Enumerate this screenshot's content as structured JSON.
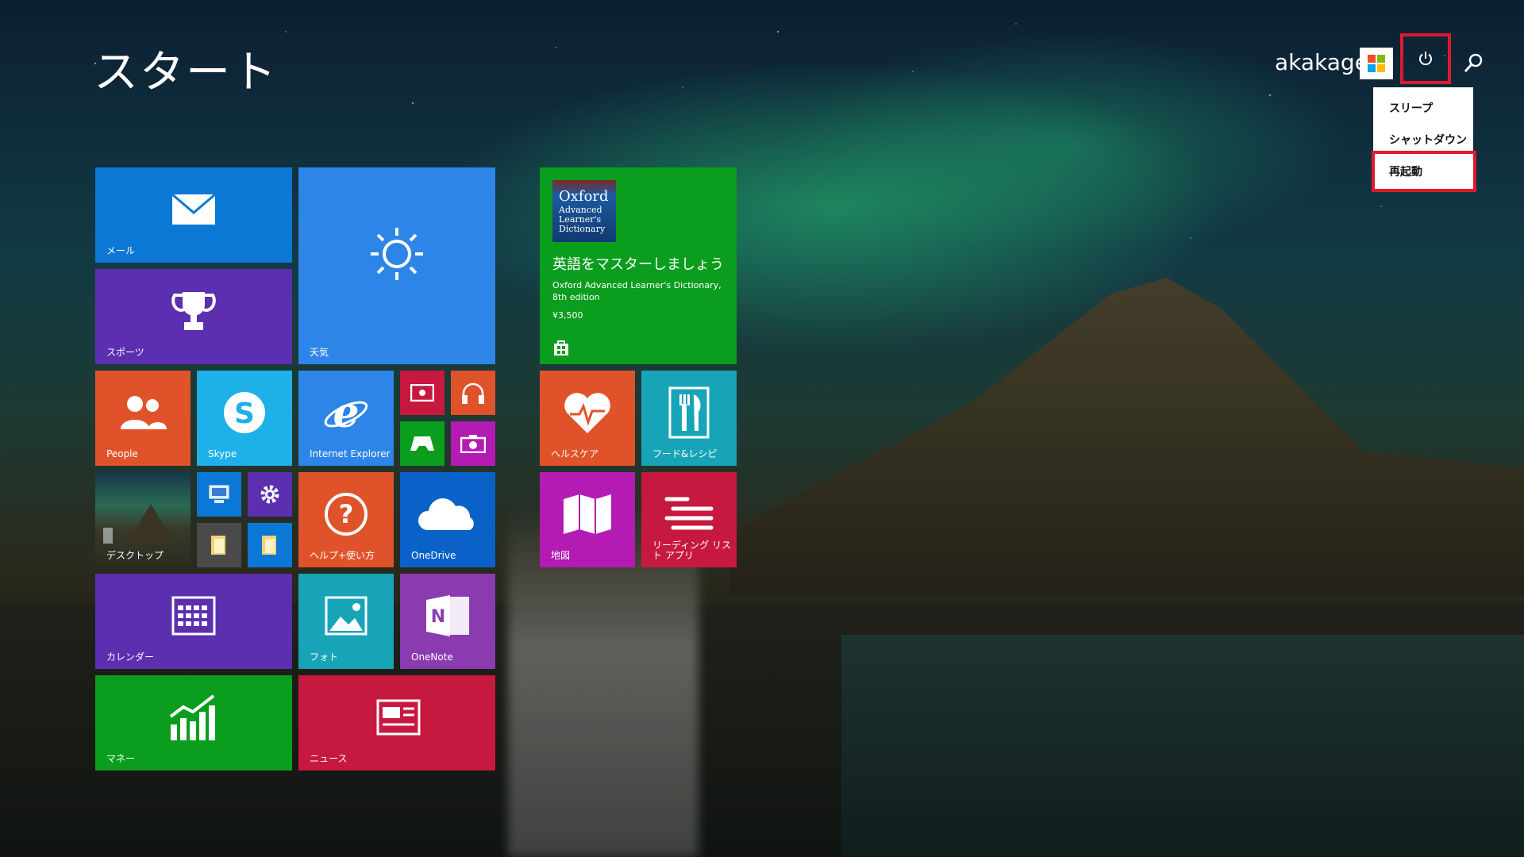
{
  "header": {
    "title": "スタート",
    "user_name": "akakage"
  },
  "power_menu": {
    "items": [
      "スリープ",
      "シャットダウン",
      "再起動"
    ]
  },
  "tiles": {
    "mail": "メール",
    "weather": "天気",
    "sports": "スポーツ",
    "people": "People",
    "skype": "Skype",
    "ie": "Internet Explorer",
    "desktop": "デスクトップ",
    "help": "ヘルプ+使い方",
    "onedrive": "OneDrive",
    "calendar": "カレンダー",
    "photos": "フォト",
    "onenote": "OneNote",
    "money": "マネー",
    "news": "ニュース",
    "health": "ヘルスケア",
    "food": "フード&レシピ",
    "maps": "地図",
    "reading": "リーディング リスト アプリ"
  },
  "store_tile": {
    "book_title": "Oxford",
    "book_sub": "Advanced Learner's Dictionary",
    "headline": "英語をマスターしましょう",
    "desc1": "Oxford Advanced Learner's Dictionary,",
    "desc2": "8th edition",
    "price": "¥3,500"
  },
  "colors": {
    "accent_red": "#e0192d",
    "blue": "#0a78d4",
    "purple": "#5b2fb0",
    "orange": "#e0532a",
    "cyan": "#1eb0e8",
    "green": "#0a9d1e",
    "magenta": "#b31bb3",
    "crimson": "#c7193f",
    "teal": "#18a4b8"
  }
}
